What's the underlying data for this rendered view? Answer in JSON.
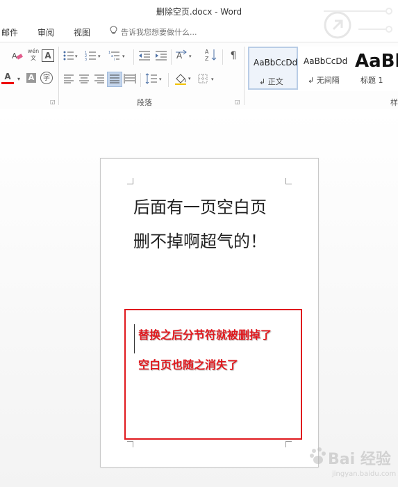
{
  "window": {
    "title": "删除空页.docx - Word"
  },
  "tabs": [
    "邮件",
    "审阅",
    "视图"
  ],
  "tell_me": {
    "placeholder": "告诉我您想要做什么..."
  },
  "ribbon": {
    "paragraph_group_label": "段落",
    "styles_group_label_partial": "样",
    "styles": [
      {
        "sample": "AaBbCcDd",
        "name": "正文",
        "selected": true
      },
      {
        "sample": "AaBbCcDd",
        "name": "无间隔",
        "selected": false
      },
      {
        "sample": "AaBl",
        "name": "标题 1",
        "selected": false
      }
    ],
    "phonetic_guide_label": "wén 文",
    "enclose_char_label": "字",
    "char_border_label": "A",
    "char_shade_label": "A",
    "font_color_label": "A",
    "sort_label": "A↓Z",
    "pilcrow_label": "¶"
  },
  "document": {
    "lines": [
      "后面有一页空白页",
      "删不掉啊超气的！"
    ]
  },
  "annotation": {
    "lines": [
      "替换之后分节符就被删掉了",
      "空白页也随之消失了"
    ],
    "color": "#e0191e"
  },
  "watermark": {
    "main": "Bai 经验",
    "sub": "jingyan.baidu.com"
  }
}
